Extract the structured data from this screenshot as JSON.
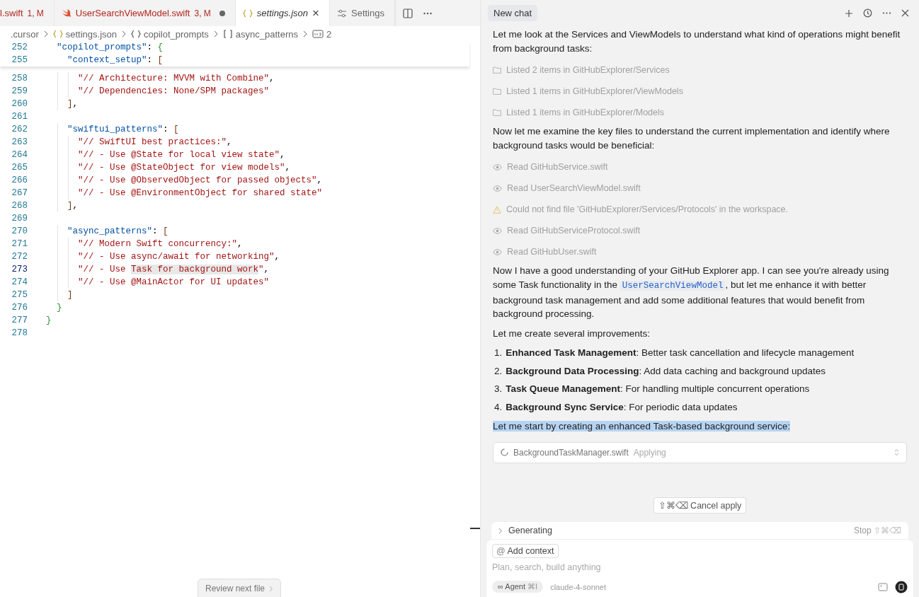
{
  "editor": {
    "tabs": [
      {
        "kind": "plain",
        "label": "l.swift",
        "status": "1, M",
        "modified": true,
        "dirty": false,
        "selected": false,
        "closable": false
      },
      {
        "kind": "swift",
        "label": "UserSearchViewModel.swift",
        "status": "3, M",
        "modified": true,
        "dirty": true,
        "selected": false,
        "closable": false
      },
      {
        "kind": "json",
        "label": "settings.json",
        "modified": false,
        "dirty": false,
        "selected": true,
        "closable": true
      },
      {
        "kind": "settings",
        "label": "Settings",
        "modified": false,
        "dirty": false,
        "selected": false,
        "closable": false
      }
    ],
    "close_glyph": "×",
    "breadcrumbs": [
      {
        "kind": "folder",
        "label": ".cursor"
      },
      {
        "kind": "file",
        "label": "settings.json"
      },
      {
        "kind": "object",
        "label": "copilot_prompts"
      },
      {
        "kind": "array",
        "label": "async_patterns"
      },
      {
        "kind": "string",
        "label": "2"
      }
    ],
    "sticky_lines": [
      {
        "number": "252",
        "tokens": [
          {
            "kind": "key",
            "text": "  \"copilot_prompts\""
          },
          {
            "kind": "punct",
            "text": ": "
          },
          {
            "kind": "brace",
            "text": "{"
          }
        ]
      },
      {
        "number": "255",
        "tokens": [
          {
            "kind": "key",
            "text": "    \"context_setup\""
          },
          {
            "kind": "punct",
            "text": ": "
          },
          {
            "kind": "bracket",
            "text": "["
          }
        ]
      }
    ],
    "lines": [
      {
        "number": "258",
        "current": false,
        "tokens": [
          {
            "kind": "string",
            "text": "      \"// Architecture: MVVM with Combine\""
          },
          {
            "kind": "punct",
            "text": ","
          }
        ]
      },
      {
        "number": "259",
        "current": false,
        "tokens": [
          {
            "kind": "string",
            "text": "      \"// Dependencies: None/SPM packages\""
          }
        ]
      },
      {
        "number": "260",
        "current": false,
        "tokens": [
          {
            "kind": "bracket",
            "text": "    ]"
          },
          {
            "kind": "punct",
            "text": ","
          }
        ]
      },
      {
        "number": "261",
        "current": false
      },
      {
        "number": "262",
        "current": false,
        "tokens": [
          {
            "kind": "key",
            "text": "    \"swiftui_patterns\""
          },
          {
            "kind": "punct",
            "text": ": "
          },
          {
            "kind": "bracket",
            "text": "["
          }
        ]
      },
      {
        "number": "263",
        "current": false,
        "tokens": [
          {
            "kind": "string",
            "text": "      \"// SwiftUI best practices:\""
          },
          {
            "kind": "punct",
            "text": ","
          }
        ]
      },
      {
        "number": "264",
        "current": false,
        "tokens": [
          {
            "kind": "string",
            "text": "      \"// - Use @State for local view state\""
          },
          {
            "kind": "punct",
            "text": ","
          }
        ]
      },
      {
        "number": "265",
        "current": false,
        "tokens": [
          {
            "kind": "string",
            "text": "      \"// - Use @StateObject for view models\""
          },
          {
            "kind": "punct",
            "text": ","
          }
        ]
      },
      {
        "number": "266",
        "current": false,
        "tokens": [
          {
            "kind": "string",
            "text": "      \"// - Use @ObservedObject for passed objects\""
          },
          {
            "kind": "punct",
            "text": ","
          }
        ]
      },
      {
        "number": "267",
        "current": false,
        "tokens": [
          {
            "kind": "string",
            "text": "      \"// - Use @EnvironmentObject for shared state\""
          }
        ]
      },
      {
        "number": "268",
        "current": false,
        "tokens": [
          {
            "kind": "bracket",
            "text": "    ]"
          },
          {
            "kind": "punct",
            "text": ","
          }
        ]
      },
      {
        "number": "269",
        "current": false
      },
      {
        "number": "270",
        "current": false,
        "tokens": [
          {
            "kind": "key",
            "text": "    \"async_patterns\""
          },
          {
            "kind": "punct",
            "text": ": "
          },
          {
            "kind": "bracket",
            "text": "["
          }
        ]
      },
      {
        "number": "271",
        "current": false,
        "tokens": [
          {
            "kind": "string",
            "text": "      \"// Modern Swift concurrency:\""
          },
          {
            "kind": "punct",
            "text": ","
          }
        ]
      },
      {
        "number": "272",
        "current": false,
        "tokens": [
          {
            "kind": "string",
            "text": "      \"// - Use async/await for networking\""
          },
          {
            "kind": "punct",
            "text": ","
          }
        ]
      },
      {
        "number": "273",
        "current": true,
        "tokens": [
          {
            "kind": "string",
            "text": "      \"// - Use "
          },
          {
            "kind": "match",
            "text": "Task for background work"
          },
          {
            "kind": "string",
            "text": "\""
          },
          {
            "kind": "punct",
            "text": ","
          }
        ]
      },
      {
        "number": "274",
        "current": false,
        "tokens": [
          {
            "kind": "string",
            "text": "      \"// - Use @MainActor for UI updates\""
          }
        ]
      },
      {
        "number": "275",
        "current": false,
        "tokens": [
          {
            "kind": "bracket",
            "text": "    ]"
          }
        ]
      },
      {
        "number": "276",
        "current": false,
        "tokens": [
          {
            "kind": "brace",
            "text": "  }"
          }
        ]
      },
      {
        "number": "277",
        "current": false,
        "tokens": [
          {
            "kind": "brace",
            "text": "}"
          }
        ]
      },
      {
        "number": "278",
        "current": false
      }
    ],
    "review_button": "Review next file"
  },
  "chat": {
    "tab": "New chat",
    "messages": [
      {
        "kind": "paragraph",
        "selected": false,
        "parts": [
          {
            "kind": "text",
            "text": "Let me look at the Services and ViewModels to understand what kind of operations might benefit from background tasks:"
          }
        ]
      },
      {
        "kind": "listed",
        "text": "Listed 2 items in GitHubExplorer/Services"
      },
      {
        "kind": "listed",
        "text": "Listed 1 items in GitHubExplorer/ViewModels"
      },
      {
        "kind": "listed",
        "text": "Listed 1 items in GitHubExplorer/Models"
      },
      {
        "kind": "paragraph",
        "selected": false,
        "parts": [
          {
            "kind": "text",
            "text": "Now let me examine the key files to understand the current implementation and identify where background tasks would be beneficial:"
          }
        ]
      },
      {
        "kind": "read",
        "text": "Read GitHubService.swift"
      },
      {
        "kind": "read",
        "text": "Read UserSearchViewModel.swift"
      },
      {
        "kind": "error",
        "text": "Could not find file 'GitHubExplorer/Services/Protocols' in the workspace."
      },
      {
        "kind": "read",
        "text": "Read GitHubServiceProtocol.swift"
      },
      {
        "kind": "read",
        "text": "Read GitHubUser.swift"
      },
      {
        "kind": "paragraph",
        "selected": false,
        "parts": [
          {
            "kind": "text",
            "text": "Now I have a good understanding of your GitHub Explorer app. I can see you're already using some Task functionality in the "
          },
          {
            "kind": "code",
            "text": "UserSearchViewModel"
          },
          {
            "kind": "text",
            "text": ", but let me enhance it with better background task management and add some additional features that would benefit from background processing."
          }
        ]
      },
      {
        "kind": "paragraph",
        "selected": false,
        "parts": [
          {
            "kind": "text",
            "text": "Let me create several improvements:"
          }
        ]
      },
      {
        "kind": "list",
        "items": [
          {
            "number": "1.",
            "text": "**Enhanced Task Management**: Better task cancellation and lifecycle management"
          },
          {
            "number": "2.",
            "text": "**Background Data Processing**: Add data caching and background updates"
          },
          {
            "number": "3.",
            "text": "**Task Queue Management**: For handling multiple concurrent operations"
          },
          {
            "number": "4.",
            "text": "**Background Sync Service**: For periodic data updates"
          }
        ]
      },
      {
        "kind": "paragraph",
        "selected": true,
        "parts": [
          {
            "kind": "text",
            "text": "Let me start by creating an enhanced Task-based background service:"
          }
        ]
      },
      {
        "kind": "apply",
        "file": "BackgroundTaskManager.swift",
        "status": "Applying"
      }
    ],
    "cancel_button": {
      "keys": "⇧⌘⌫",
      "label": "Cancel apply"
    },
    "generating": {
      "label": "Generating",
      "stop": "Stop",
      "stop_keys": "⇧⌘⌫"
    },
    "composer": {
      "context_symbol": "@",
      "context_button": "Add context",
      "placeholder": "Plan, search, build anything",
      "mode_symbol": "∞",
      "mode": "Agent",
      "mode_keys": "⌘I",
      "model": "claude-4-sonnet"
    }
  }
}
